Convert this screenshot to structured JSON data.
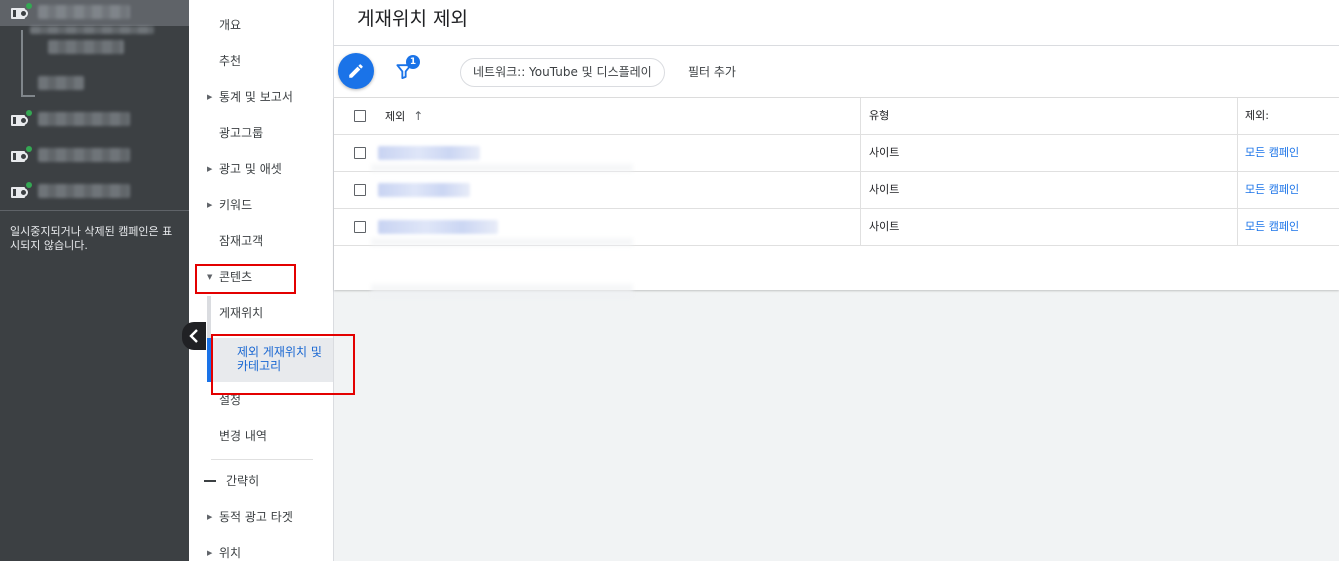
{
  "left_panel": {
    "note": "일시중지되거나 삭제된 캠페인은 표시되지 않습니다."
  },
  "nav": {
    "items": [
      {
        "label": "개요"
      },
      {
        "label": "추천"
      },
      {
        "label": "통계 및 보고서"
      },
      {
        "label": "광고그룹"
      },
      {
        "label": "광고 및 애셋"
      },
      {
        "label": "키워드"
      },
      {
        "label": "잠재고객"
      },
      {
        "label": "콘텐츠"
      },
      {
        "label": "게재위치"
      },
      {
        "label": "제외 게재위치 및 카테고리"
      },
      {
        "label": "설정"
      },
      {
        "label": "변경 내역"
      },
      {
        "label": "간략히"
      },
      {
        "label": "동적 광고 타겟"
      },
      {
        "label": "위치"
      }
    ]
  },
  "page": {
    "title": "게재위치 제외"
  },
  "toolbar": {
    "filter_badge": "1",
    "filter_chip": "네트워크:: YouTube 및 디스플레이",
    "add_filter": "필터 추가"
  },
  "table": {
    "headers": {
      "name": "제외",
      "type": "유형",
      "exclusion": "제외:"
    },
    "rows": [
      {
        "type": "사이트",
        "exclusion": "모든 캠페인"
      },
      {
        "type": "사이트",
        "exclusion": "모든 캠페인"
      },
      {
        "type": "사이트",
        "exclusion": "모든 캠페인"
      }
    ]
  },
  "colors": {
    "accent": "#1a73e8",
    "highlight": "#e30000",
    "sidebar": "#3c4043"
  }
}
